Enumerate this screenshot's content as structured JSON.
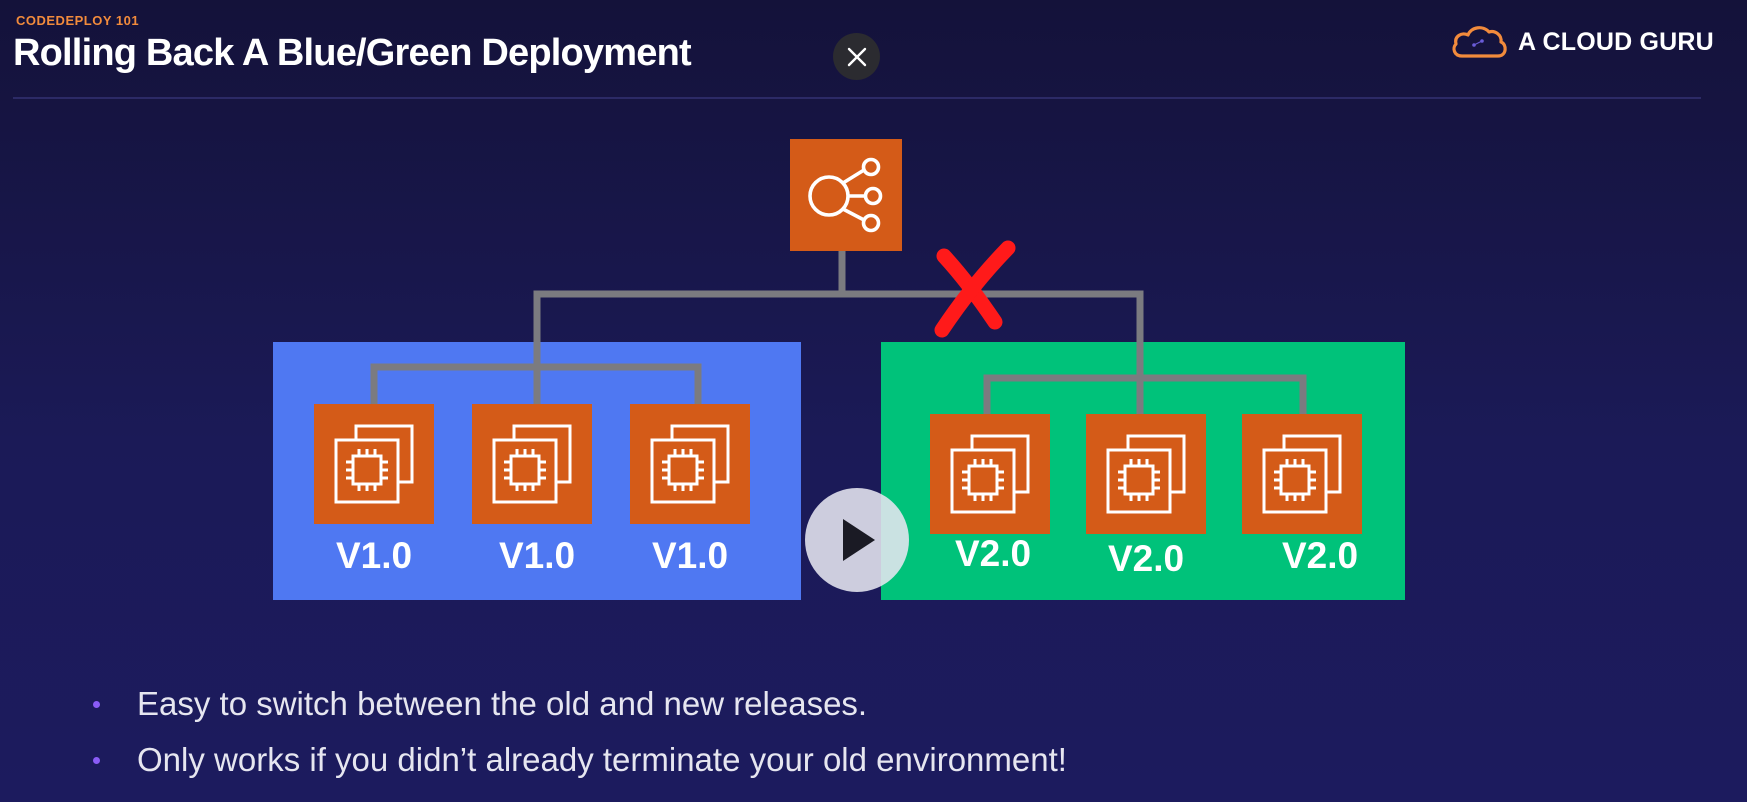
{
  "header": {
    "course": "CODEDEPLOY 101",
    "title": "Rolling Back A Blue/Green Deployment",
    "logo_text": "A CLOUD GURU",
    "close_icon": "close-icon",
    "logo_icon": "cloud-icon"
  },
  "diagram": {
    "load_balancer_icon": "elastic-load-balancer-icon",
    "instance_icon": "ec2-instance-icon",
    "disconnect_mark": "red-x-icon",
    "blue_environment": {
      "color": "#4f78f2",
      "instances": [
        {
          "label": "V1.0"
        },
        {
          "label": "V1.0"
        },
        {
          "label": "V1.0"
        }
      ]
    },
    "green_environment": {
      "color": "#00c27a",
      "instances": [
        {
          "label": "V2.0"
        },
        {
          "label": "V2.0"
        },
        {
          "label": "V2.0"
        }
      ]
    },
    "instance_color": "#d45b18",
    "connector_color": "#7b7b80",
    "x_color": "#ff1a1a"
  },
  "player": {
    "play_icon": "play-icon"
  },
  "bullets": [
    "Easy to switch between the old and new releases.",
    "Only works if you didn’t already terminate your old environment!"
  ],
  "colors": {
    "accent_orange": "#f28b3c",
    "bullet_purple": "#8a5cf6"
  }
}
